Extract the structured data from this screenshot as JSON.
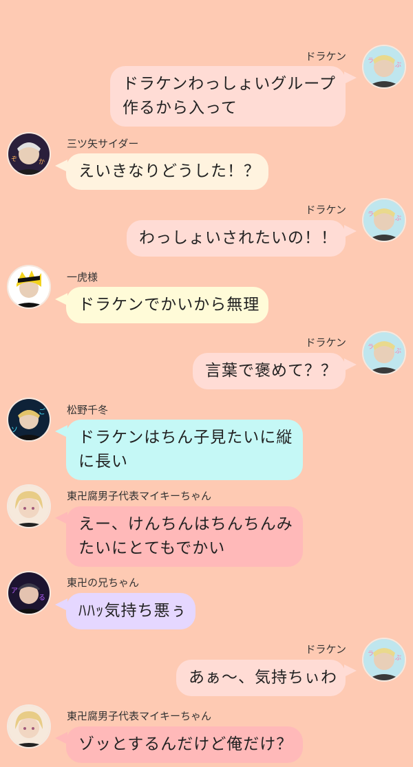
{
  "messages": [
    {
      "side": "right",
      "name": "ドラケン",
      "lines": [
        "ドラケンわっしょいグループ",
        "作るから入って"
      ],
      "bubble_color": "#ffdcd5",
      "avatar": "draken"
    },
    {
      "side": "left",
      "name": "三ツ矢サイダー",
      "lines": [
        "えいきなりどうした！？"
      ],
      "bubble_color": "#fff3df",
      "avatar": "mitsuya"
    },
    {
      "side": "right",
      "name": "ドラケン",
      "lines": [
        "わっしょいされたいの！！"
      ],
      "bubble_color": "#ffdcd5",
      "avatar": "draken"
    },
    {
      "side": "left",
      "name": "一虎様",
      "lines": [
        "ドラケンでかいから無理"
      ],
      "bubble_color": "#fffbd8",
      "avatar": "kazutora"
    },
    {
      "side": "right",
      "name": "ドラケン",
      "lines": [
        "言葉で褒めて？？"
      ],
      "bubble_color": "#ffdcd5",
      "avatar": "draken"
    },
    {
      "side": "left",
      "name": "松野千冬",
      "lines": [
        "ドラケンはちん子見たいに縦",
        "に長い"
      ],
      "bubble_color": "#c5f8f6",
      "avatar": "chifuyu"
    },
    {
      "side": "left",
      "name": "東卍腐男子代表マイキーちゃん",
      "lines": [
        "えー、けんちんはちんちんみ",
        "たいにとてもでかい"
      ],
      "bubble_color": "#ffb9b9",
      "avatar": "mikey"
    },
    {
      "side": "left",
      "name": "東卍の兄ちゃん",
      "lines": [
        "ﾊﾊｯ気持ち悪ぅ"
      ],
      "bubble_color": "#e5d7ff",
      "avatar": "hakkai"
    },
    {
      "side": "right",
      "name": "ドラケン",
      "lines": [
        "あぁ〜、気持ちぃわ"
      ],
      "bubble_color": "#ffdcd5",
      "avatar": "draken"
    },
    {
      "side": "left",
      "name": "東卍腐男子代表マイキーちゃん",
      "lines": [
        "ゾッとするんだけど俺だけ？"
      ],
      "bubble_color": "#ffb9b9",
      "avatar": "mikey"
    }
  ]
}
